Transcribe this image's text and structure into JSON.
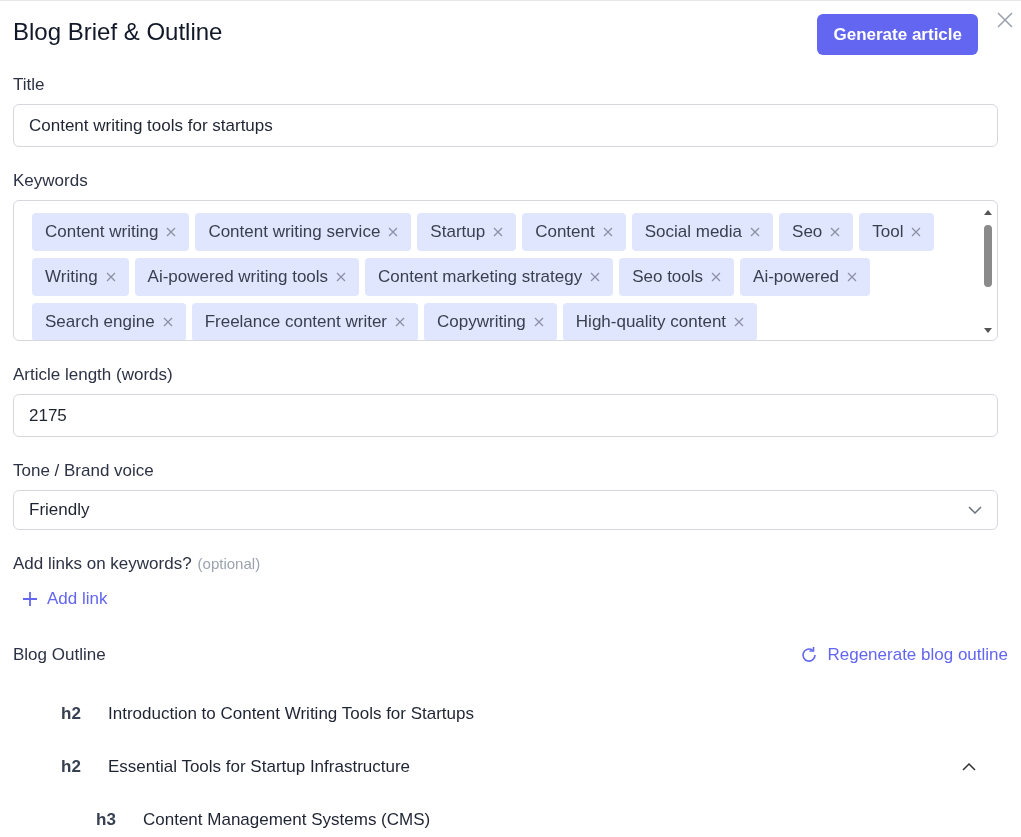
{
  "header": {
    "title": "Blog Brief & Outline",
    "generate_button": "Generate article"
  },
  "title_field": {
    "label": "Title",
    "value": "Content writing tools for startups"
  },
  "keywords": {
    "label": "Keywords",
    "tags": [
      "Content writing",
      "Content writing service",
      "Startup",
      "Content",
      "Social media",
      "Seo",
      "Tool",
      "Writing",
      "Ai-powered writing tools",
      "Content marketing strategy",
      "Seo tools",
      "Ai-powered",
      "Search engine",
      "Freelance content writer",
      "Copywriting",
      "High-quality content"
    ]
  },
  "length_field": {
    "label": "Article length (words)",
    "value": "2175"
  },
  "tone_field": {
    "label": "Tone / Brand voice",
    "value": "Friendly"
  },
  "links": {
    "label": "Add links on keywords?",
    "hint": "(optional)",
    "add_button": "Add link"
  },
  "outline": {
    "label": "Blog Outline",
    "regenerate_button": "Regenerate blog outline",
    "items": [
      {
        "level": "h2",
        "text": "Introduction to Content Writing Tools for Startups"
      },
      {
        "level": "h2",
        "text": "Essential Tools for Startup Infrastructure",
        "expanded": true,
        "children": [
          {
            "level": "h3",
            "text": "Content Management Systems (CMS)"
          }
        ]
      }
    ]
  }
}
